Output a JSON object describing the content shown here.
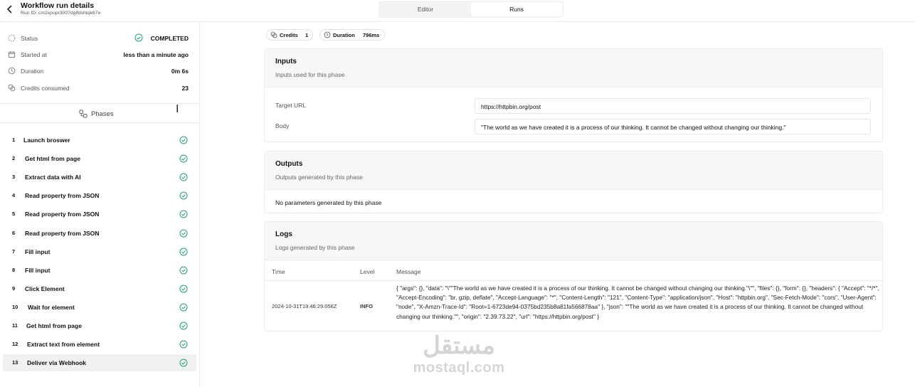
{
  "header": {
    "title": "Workflow run details",
    "run_id": "Run ID: cm2xpupr3007dglfdshtqk67e",
    "tabs": [
      "Editor",
      "Runs"
    ],
    "active_tab": "Runs"
  },
  "stats": [
    {
      "label": "Status",
      "value": "COMPLETED",
      "icon": "loader-icon"
    },
    {
      "label": "Started at",
      "value": "less than a minute ago",
      "icon": "calendar-icon"
    },
    {
      "label": "Duration",
      "value": "0m 6s",
      "icon": "clock-icon"
    },
    {
      "label": "Credits consumed",
      "value": "23",
      "icon": "coins-icon"
    }
  ],
  "phases_heading": "Phases",
  "phases": [
    {
      "num": "1",
      "name": "Launch broswer"
    },
    {
      "num": "2",
      "name": "Get html from page"
    },
    {
      "num": "3",
      "name": "Extract data with AI"
    },
    {
      "num": "4",
      "name": "Read property from JSON"
    },
    {
      "num": "5",
      "name": "Read property from JSON"
    },
    {
      "num": "6",
      "name": "Read property from JSON"
    },
    {
      "num": "7",
      "name": "Fill input"
    },
    {
      "num": "8",
      "name": "Fill input"
    },
    {
      "num": "9",
      "name": "Click Element"
    },
    {
      "num": "10",
      "name": "Wait for element"
    },
    {
      "num": "11",
      "name": "Get html from page"
    },
    {
      "num": "12",
      "name": "Extract text from element"
    },
    {
      "num": "13",
      "name": "Deliver via Webhook"
    }
  ],
  "selected_phase": "13",
  "badges": {
    "credits_label": "Credits",
    "credits_value": "1",
    "duration_label": "Duration",
    "duration_value": "796ms"
  },
  "inputs": {
    "title": "Inputs",
    "subtitle": "Inputs used for this phase",
    "target_url_label": "Target URL",
    "target_url_value": "https://httpbin.org/post",
    "body_label": "Body",
    "body_value": "\"The world as we have created it is a process of our thinking. It cannot be changed without changing our thinking.\""
  },
  "outputs": {
    "title": "Outputs",
    "subtitle": "Outputs generated by this phase",
    "empty_text": "No parameters generated by this phase"
  },
  "logs": {
    "title": "Logs",
    "subtitle": "Logs generated by this phase",
    "headers": [
      "Time",
      "Level",
      "Message"
    ],
    "rows": [
      {
        "time": "2024-10-31T19:46:29.056Z",
        "level": "INFO",
        "message": "{ \"args\": {}, \"data\": \"\\\"\"The world as we have created it is a process of our thinking. It cannot be changed without changing our thinking.\"\\\"\", \"files\": {}, \"form\": {}, \"headers\": { \"Accept\": \"*/*\", \"Accept-Encoding\": \"br, gzip, deflate\", \"Accept-Language\": \"*\", \"Content-Length\": \"121\", \"Content-Type\": \"application/json\", \"Host\": \"httpbin.org\", \"Sec-Fetch-Mode\": \"cors\", \"User-Agent\": \"node\", \"X-Amzn-Trace-Id\": \"Root=1-6723de94-0375bd235b8a81fa566878aa\" }, \"json\": \"\"The world as we have created it is a process of our thinking. It cannot be changed without changing our thinking.\"\", \"origin\": \"2.39.73.22\", \"url\": \"https://httpbin.org/post\" }"
      }
    ]
  },
  "watermark": {
    "arabic": "مستقل",
    "latin": "mostaql.com"
  },
  "colors": {
    "success": "#22a06b",
    "border": "#ececec"
  }
}
